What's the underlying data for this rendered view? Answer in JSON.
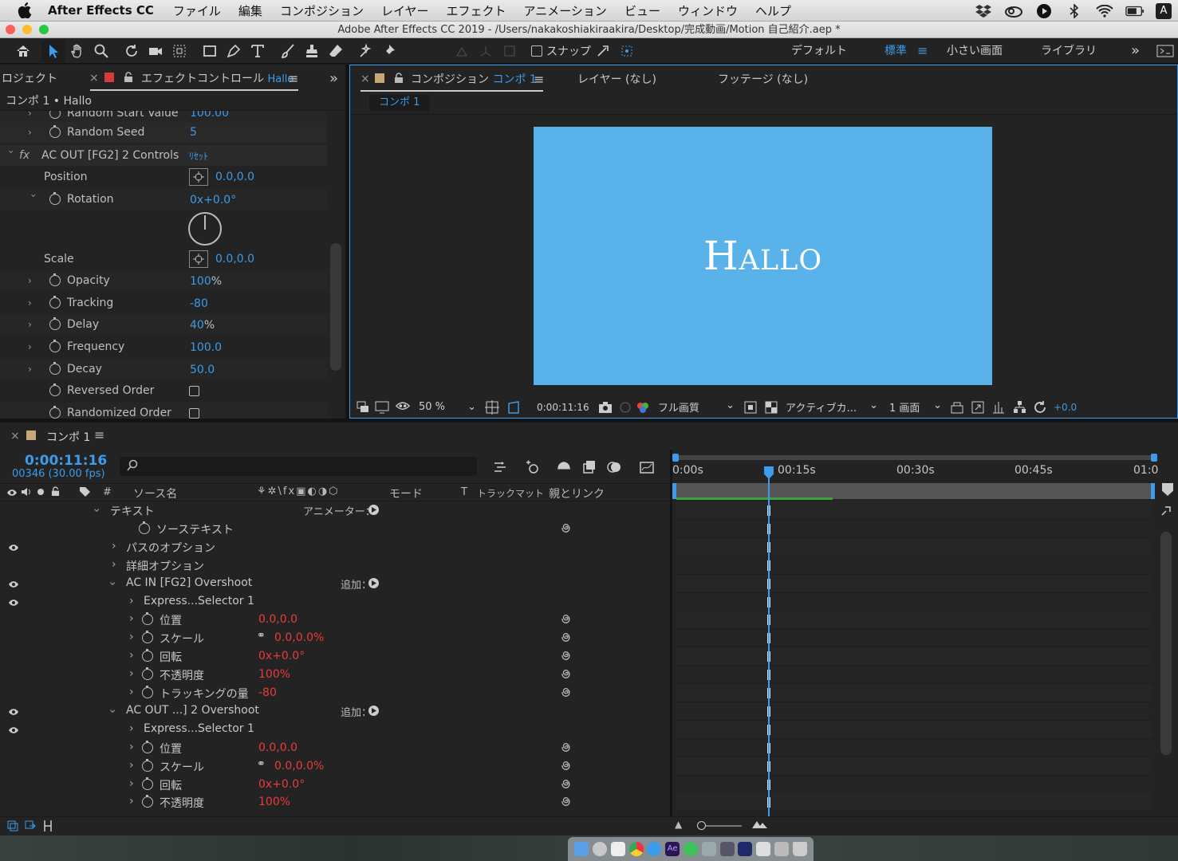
{
  "menubar": {
    "app_name": "After Effects CC",
    "items": [
      "ファイル",
      "編集",
      "コンポジション",
      "レイヤー",
      "エフェクト",
      "アニメーション",
      "ビュー",
      "ウィンドウ",
      "ヘルプ"
    ],
    "input_indicator": "A"
  },
  "window": {
    "title": "Adobe After Effects CC 2019 - /Users/nakakoshiakiraakira/Desktop/完成動画/Motion 自己紹介.aep *"
  },
  "toolbar": {
    "snap_label": "スナップ",
    "workspaces": [
      "デフォルト",
      "標準",
      "小さい画面",
      "ライブラリ"
    ],
    "active_workspace": "標準"
  },
  "effect_panel": {
    "project_tab": "ロジェクト",
    "tab_label": "エフェクトコントロール",
    "tab_layer": "Hallo",
    "breadcrumb": "コンポ 1 • Hallo",
    "partial_row": {
      "name": "Random Start Value",
      "value": "100.00"
    },
    "random_seed": {
      "name": "Random Seed",
      "value": "5"
    },
    "effect_group": {
      "name": "AC OUT [FG2] 2 Controls",
      "reset": "ﾘｾｯﾄ"
    },
    "position": {
      "name": "Position",
      "value": "0.0,0.0"
    },
    "rotation": {
      "name": "Rotation",
      "value": "0x+0.0°"
    },
    "scale": {
      "name": "Scale",
      "value": "0.0,0.0"
    },
    "params": [
      {
        "name": "Opacity",
        "value": "100",
        "unit": "%"
      },
      {
        "name": "Tracking",
        "value": "-80",
        "unit": ""
      },
      {
        "name": "Delay",
        "value": "40",
        "unit": "%"
      },
      {
        "name": "Frequency",
        "value": "100.0",
        "unit": ""
      },
      {
        "name": "Decay",
        "value": "50.0",
        "unit": ""
      }
    ],
    "checkboxes": [
      {
        "name": "Reversed Order",
        "checked": false
      },
      {
        "name": "Randomized Order",
        "checked": false
      }
    ]
  },
  "comp_panel": {
    "tab_label": "コンポジション",
    "tab_comp": "コンポ 1",
    "layer_tab": "レイヤー (なし)",
    "footage_tab": "フッテージ (なし)",
    "sub_tab": "コンポ 1",
    "canvas_text": "Hallo",
    "canvas_color": "#5ab2ea",
    "footer": {
      "zoom": "50 %",
      "timecode": "0:00:11:16",
      "quality": "フル画質",
      "camera": "アクティブカ...",
      "views": "1 画面",
      "exposure": "+0.0"
    }
  },
  "timeline": {
    "tab_label": "コンポ 1",
    "current_time": "0:00:11:16",
    "frame_info": "00346 (30.00 fps)",
    "columns": {
      "num": "#",
      "source": "ソース名",
      "mode": "モード",
      "t": "T",
      "trackmatte": "トラックマット",
      "parent": "親とリンク"
    },
    "ruler": [
      "0:00s",
      "00:15s",
      "00:30s",
      "00:45s",
      "01:0"
    ],
    "rows": [
      {
        "label": "テキスト",
        "extra": "アニメーター：",
        "eye": false,
        "indent": 1,
        "kind": "group-open"
      },
      {
        "label": "ソーステキスト",
        "eye": false,
        "indent": 2,
        "kind": "stopwatch",
        "spiral": true
      },
      {
        "label": "パスのオプション",
        "eye": true,
        "indent": 2,
        "kind": "closed"
      },
      {
        "label": "詳細オプション",
        "eye": false,
        "indent": 2,
        "kind": "closed"
      },
      {
        "label": "AC IN [FG2] Overshoot",
        "extra": "追加：",
        "eye": true,
        "indent": 2,
        "kind": "group-open"
      },
      {
        "label": "Express...Selector 1",
        "eye": true,
        "indent": 3,
        "kind": "closed"
      },
      {
        "label": "位置",
        "value": "0.0,0.0",
        "eye": false,
        "indent": 3,
        "kind": "prop",
        "spiral": true
      },
      {
        "label": "スケール",
        "value": "0.0,0.0%",
        "link": true,
        "eye": false,
        "indent": 3,
        "kind": "prop",
        "spiral": true
      },
      {
        "label": "回転",
        "value": "0x+0.0°",
        "eye": false,
        "indent": 3,
        "kind": "prop",
        "spiral": true
      },
      {
        "label": "不透明度",
        "value": "100%",
        "eye": false,
        "indent": 3,
        "kind": "prop",
        "spiral": true
      },
      {
        "label": "トラッキングの量",
        "value": "-80",
        "eye": false,
        "indent": 3,
        "kind": "prop",
        "spiral": true
      },
      {
        "label": "AC OUT ...] 2 Overshoot",
        "extra": "追加：",
        "eye": true,
        "indent": 2,
        "kind": "group-open"
      },
      {
        "label": "Express...Selector 1",
        "eye": true,
        "indent": 3,
        "kind": "closed"
      },
      {
        "label": "位置",
        "value": "0.0,0.0",
        "eye": false,
        "indent": 3,
        "kind": "prop",
        "spiral": true
      },
      {
        "label": "スケール",
        "value": "0.0,0.0%",
        "link": true,
        "eye": false,
        "indent": 3,
        "kind": "prop",
        "spiral": true
      },
      {
        "label": "回転",
        "value": "0x+0.0°",
        "eye": false,
        "indent": 3,
        "kind": "prop",
        "spiral": true
      },
      {
        "label": "不透明度",
        "value": "100%",
        "eye": false,
        "indent": 3,
        "kind": "prop",
        "spiral": true
      }
    ]
  },
  "colors": {
    "accent": "#3c9bea",
    "value_red": "#ea3b3b",
    "work_area": "#3da33d"
  }
}
